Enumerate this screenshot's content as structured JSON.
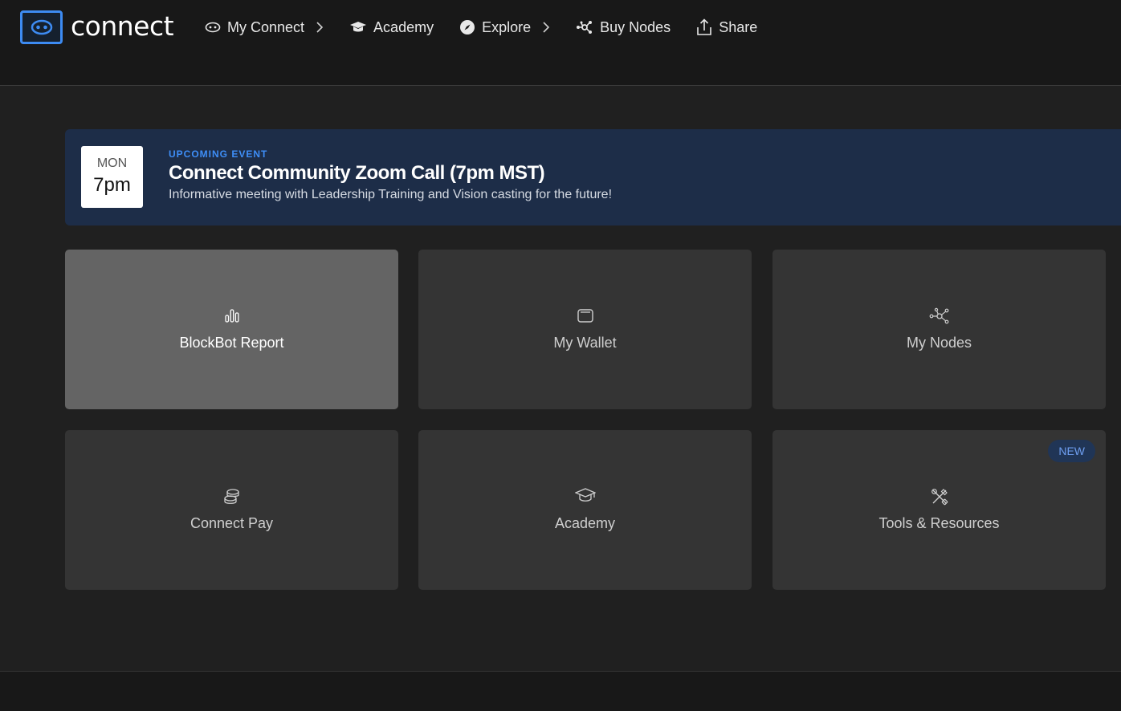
{
  "app": {
    "logo_text": "connect",
    "brand_color": "#3d8bf2"
  },
  "nav": {
    "items": [
      {
        "label": "My Connect",
        "icon": "eye-icon",
        "has_chevron": true
      },
      {
        "label": "Academy",
        "icon": "graduation-cap-icon",
        "has_chevron": false
      },
      {
        "label": "Explore",
        "icon": "compass-icon",
        "has_chevron": true
      },
      {
        "label": "Buy Nodes",
        "icon": "nodes-icon",
        "has_chevron": false
      },
      {
        "label": "Share",
        "icon": "share-icon",
        "has_chevron": false
      }
    ]
  },
  "event": {
    "day": "MON",
    "time": "7pm",
    "kicker": "UPCOMING EVENT",
    "title": "Connect Community Zoom Call (7pm MST)",
    "subtitle": "Informative meeting with Leadership Training and Vision casting for the future!"
  },
  "cards": [
    {
      "label": "BlockBot Report",
      "icon": "bar-chart-icon",
      "active": true
    },
    {
      "label": "My Wallet",
      "icon": "wallet-icon",
      "active": false
    },
    {
      "label": "My Nodes",
      "icon": "network-icon",
      "active": false
    },
    {
      "label": "Connect Pay",
      "icon": "coins-icon",
      "active": false
    },
    {
      "label": "Academy",
      "icon": "graduation-cap-icon",
      "active": false
    },
    {
      "label": "Tools & Resources",
      "icon": "tools-icon",
      "active": false,
      "badge": "NEW"
    }
  ]
}
